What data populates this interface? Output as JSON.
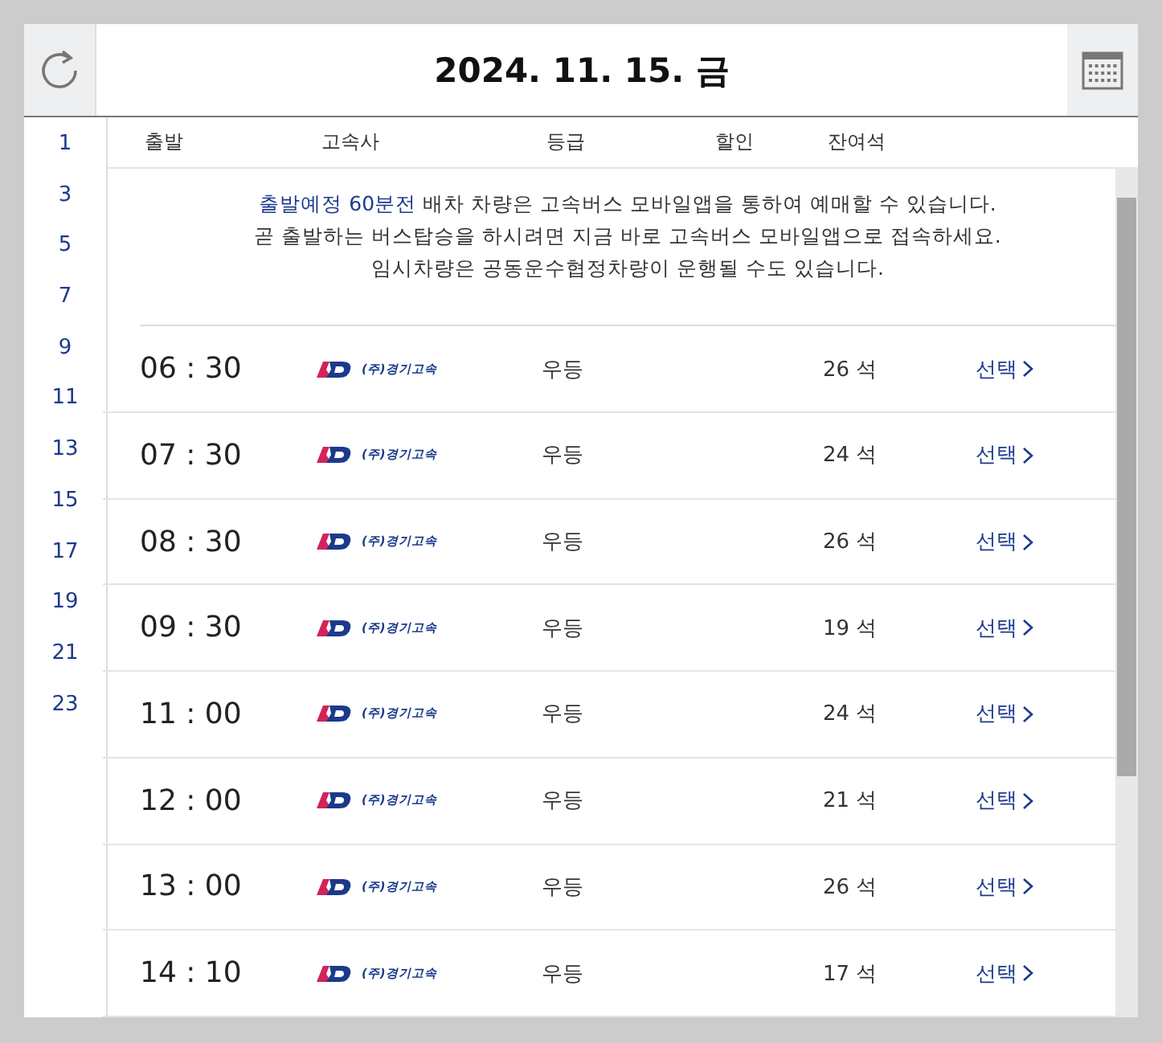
{
  "header": {
    "date": "2024. 11. 15. 금"
  },
  "hours": [
    "1",
    "3",
    "5",
    "7",
    "9",
    "11",
    "13",
    "15",
    "17",
    "19",
    "21",
    "23"
  ],
  "columns": [
    "출발",
    "고속사",
    "등급",
    "할인",
    "잔여석"
  ],
  "notice": {
    "highlight": "출발예정 60분전",
    "first_rest": " 배차 차량은 고속버스 모바일앱을 통하여 예매할 수 있습니다.",
    "lines": [
      "곧 출발하는 버스탑승을 하시려면 지금 바로 고속버스 모바일앱으로 접속하세요.",
      "임시차량은 공동운수협정차량이 운행될 수도 있습니다."
    ]
  },
  "rows": [
    {
      "time": "06 : 30",
      "company": "(주)경기고속",
      "grade": "우등",
      "seats": "26 석",
      "action": "선택"
    },
    {
      "time": "07 : 30",
      "company": "(주)경기고속",
      "grade": "우등",
      "seats": "24 석",
      "action": "선택"
    },
    {
      "time": "08 : 30",
      "company": "(주)경기고속",
      "grade": "우등",
      "seats": "26 석",
      "action": "선택"
    },
    {
      "time": "09 : 30",
      "company": "(주)경기고속",
      "grade": "우등",
      "seats": "19 석",
      "action": "선택"
    },
    {
      "time": "11 : 00",
      "company": "(주)경기고속",
      "grade": "우등",
      "seats": "24 석",
      "action": "선택"
    },
    {
      "time": "12 : 00",
      "company": "(주)경기고속",
      "grade": "우등",
      "seats": "21 석",
      "action": "선택"
    },
    {
      "time": "13 : 00",
      "company": "(주)경기고속",
      "grade": "우등",
      "seats": "26 석",
      "action": "선택"
    },
    {
      "time": "14 : 10",
      "company": "(주)경기고속",
      "grade": "우등",
      "seats": "17 석",
      "action": "선택"
    }
  ]
}
